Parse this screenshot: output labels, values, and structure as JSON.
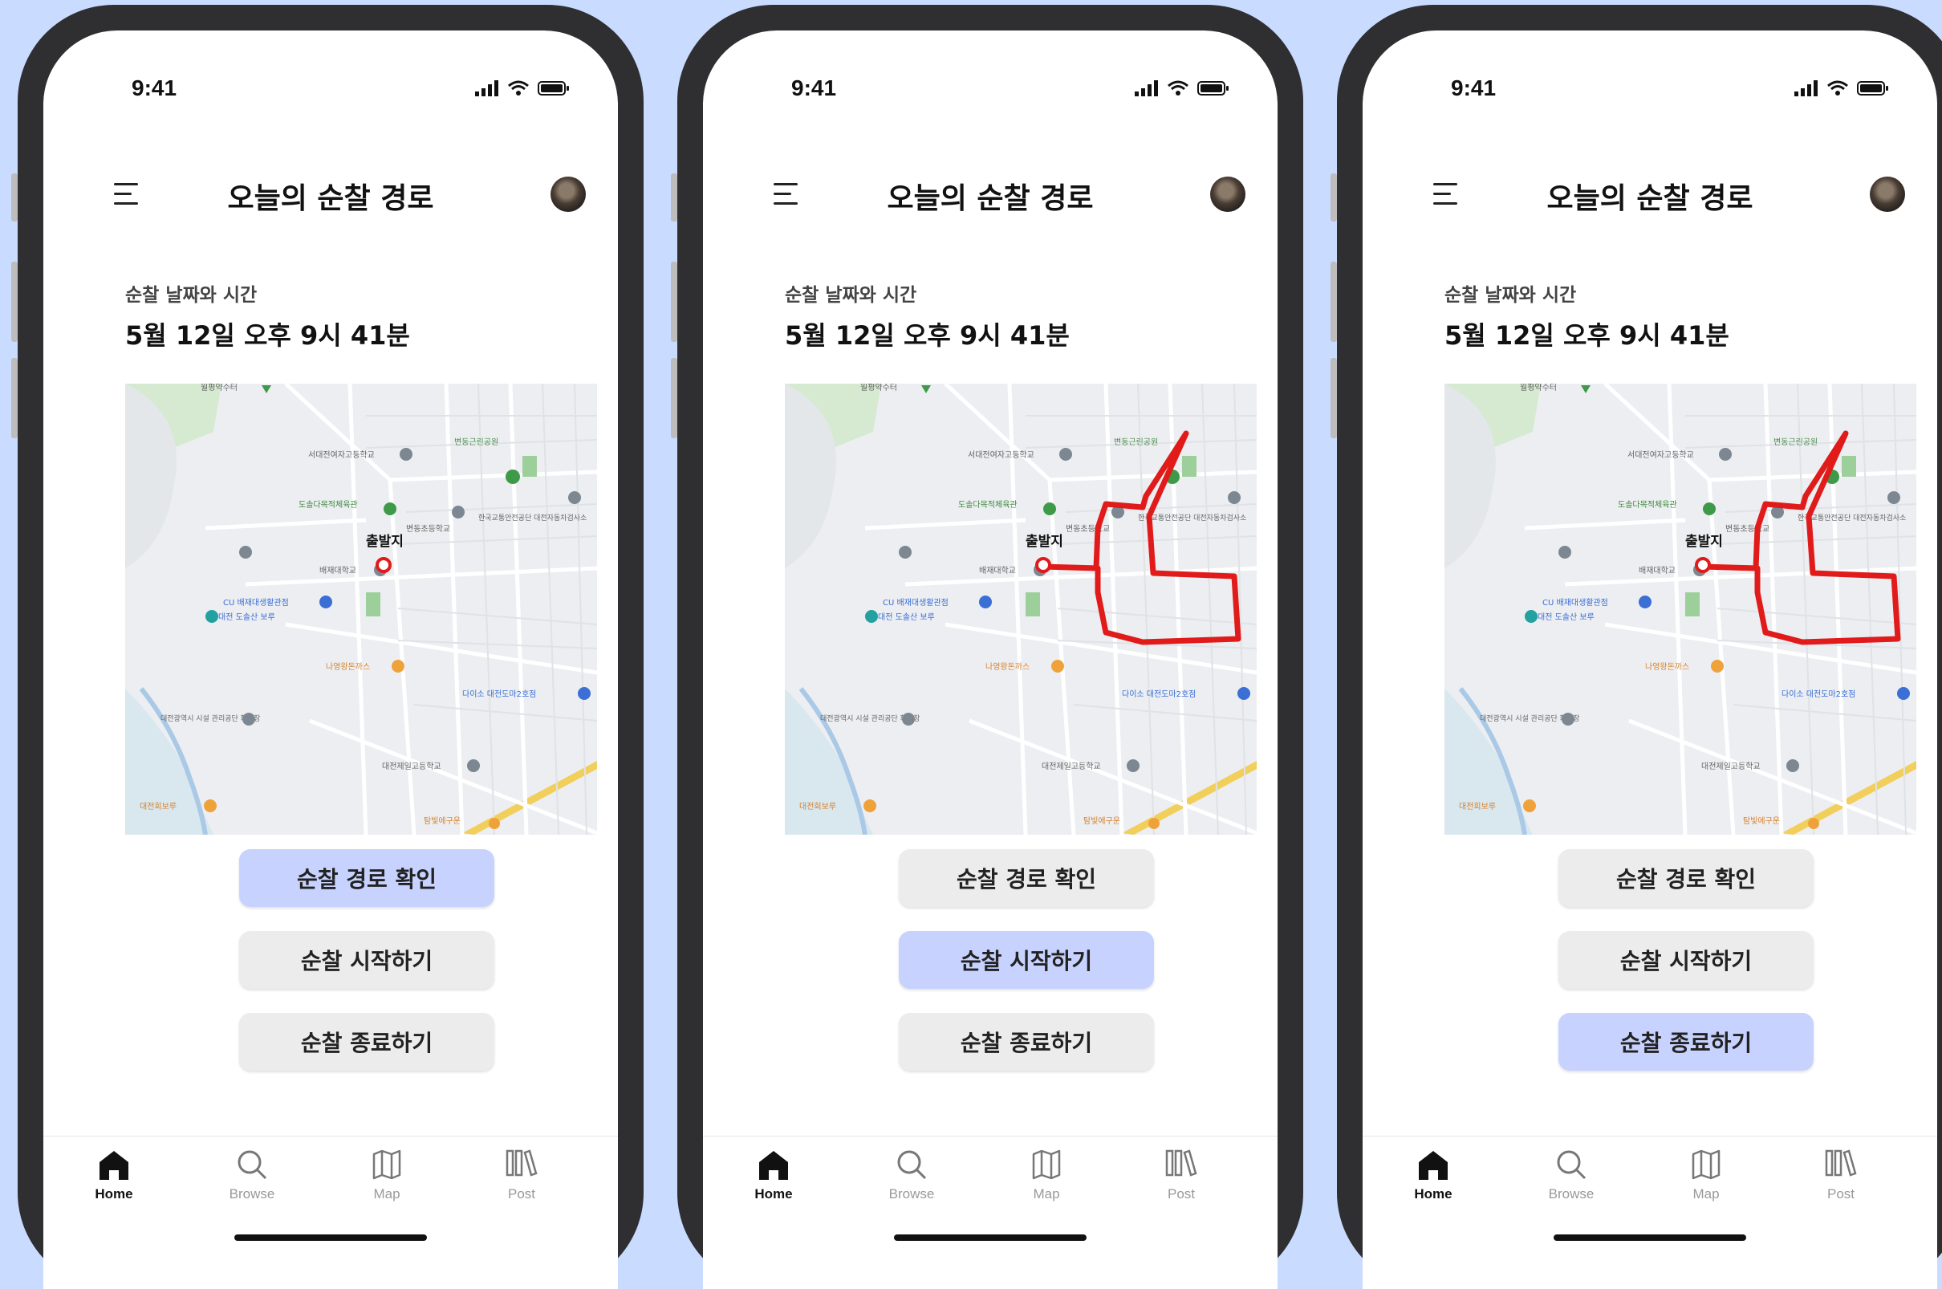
{
  "status": {
    "time": "9:41"
  },
  "screen": {
    "title": "오늘의 순찰 경로",
    "date_label": "순찰 날짜와 시간",
    "date_value": "5월 12일 오후 9시 41분"
  },
  "map": {
    "start_marker_label": "출발지",
    "places": {
      "p1": "월평약수터",
      "p2": "서대전여자고등학교",
      "p3": "변동근린공원",
      "p4": "도솔다목적체육관",
      "p5": "변동초등학교",
      "p6": "한국교통안전공단 대전자동차검사소",
      "p7": "배재대학교",
      "p8": "CU 배재대생활관점",
      "p9": "대전 도솔산 보루",
      "p10": "나영왕돈까스",
      "p11": "다이소 대전도마2호점",
      "p12": "대전광역시 시설 관리공단 화장장",
      "p13": "대전제일고등학교",
      "p14": "대전회보루",
      "p15": "탐빛에구운"
    }
  },
  "buttons": {
    "check_route": "순찰 경로 확인",
    "start_patrol": "순찰 시작하기",
    "end_patrol": "순찰 종료하기"
  },
  "tabs": {
    "home": "Home",
    "browse": "Browse",
    "map": "Map",
    "post": "Post"
  },
  "phones": [
    {
      "active_button": "check_route",
      "route_shown": false
    },
    {
      "active_button": "start_patrol",
      "route_shown": true
    },
    {
      "active_button": "end_patrol",
      "route_shown": true
    }
  ],
  "colors": {
    "background": "#c9dbff",
    "active_button": "#c8d2ff",
    "route": "#e11a1a",
    "inactive_button": "#ececec"
  }
}
